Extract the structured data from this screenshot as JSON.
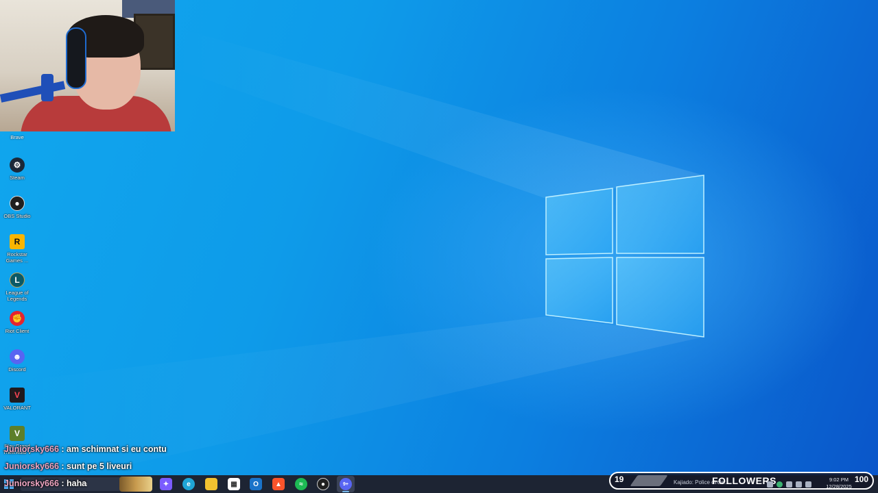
{
  "desktop": {
    "brave_label": "Brave",
    "icons": [
      {
        "label": "Steam",
        "icon": "steam-icon",
        "color": "#1b2838"
      },
      {
        "label": "OBS Studio",
        "icon": "obs-icon",
        "color": "#202020"
      },
      {
        "label": "Rockstar Games ...",
        "icon": "rockstar-icon",
        "color": "#f9b500"
      },
      {
        "label": "League of Legends",
        "icon": "league-icon",
        "color": "#0a5a67"
      },
      {
        "label": "Riot Client",
        "icon": "riot-icon",
        "color": "#e5242f"
      },
      {
        "label": "Discord",
        "icon": "discord-icon",
        "color": "#5865f2"
      },
      {
        "label": "VALORANT",
        "icon": "valorant-icon",
        "color": "#1f1a1e"
      },
      {
        "label": "Play Grand Theft Auto V",
        "icon": "gta-icon",
        "color": "#5d7f2a"
      }
    ]
  },
  "chat": [
    {
      "user": "Juniorsky666",
      "sep": " : ",
      "message": "am schimnat si eu contu"
    },
    {
      "user": "Juniorsky666",
      "sep": " : ",
      "message": "sunt pe 5 liveuri"
    },
    {
      "user": "Juniorsky666",
      "sep": " : ",
      "message": "haha"
    }
  ],
  "taskbar": {
    "search_text": "ch",
    "apps": [
      {
        "name": "copilot-icon",
        "color": "#7b5cff"
      },
      {
        "name": "edge-icon",
        "color": "#1fa5d6"
      },
      {
        "name": "file-explorer-icon",
        "color": "#f2c230"
      },
      {
        "name": "microsoft-store-icon",
        "color": "#ffffff"
      },
      {
        "name": "outlook-icon",
        "color": "#1a73c9"
      },
      {
        "name": "brave-icon",
        "color": "#fb542b"
      },
      {
        "name": "spotify-icon",
        "color": "#1db954"
      },
      {
        "name": "obs-icon",
        "color": "#202020"
      },
      {
        "name": "discord-icon",
        "color": "#5865f2"
      }
    ],
    "discord_badge": "9+",
    "clock_time": "9:02 PM",
    "clock_date": "12/28/2025"
  },
  "followers_overlay": {
    "count": "19",
    "title": "FOLLOWERS",
    "goal": "100",
    "ticker": "Kajiado: Police circle..."
  },
  "colors": {
    "chat_username": "#f0a6c3",
    "taskbar_bg": "#1d2433",
    "wallpaper_accent": "#11a7ee"
  }
}
